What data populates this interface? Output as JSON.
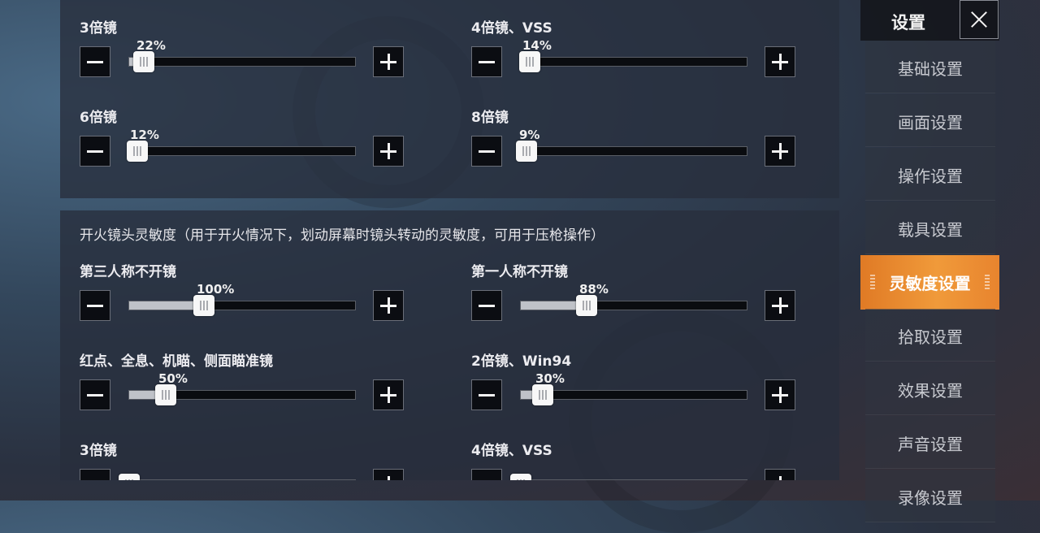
{
  "sidebar": {
    "title": "设置",
    "items": [
      {
        "label": "基础设置",
        "active": false
      },
      {
        "label": "画面设置",
        "active": false
      },
      {
        "label": "操作设置",
        "active": false
      },
      {
        "label": "载具设置",
        "active": false
      },
      {
        "label": "灵敏度设置",
        "active": true
      },
      {
        "label": "拾取设置",
        "active": false
      },
      {
        "label": "效果设置",
        "active": false
      },
      {
        "label": "声音设置",
        "active": false
      },
      {
        "label": "录像设置",
        "active": false
      }
    ]
  },
  "scope_section": {
    "settings": [
      {
        "label": "3倍镜",
        "value_text": "22%",
        "fraction": 0.065
      },
      {
        "label": "4倍镜、VSS",
        "value_text": "14%",
        "fraction": 0.04
      },
      {
        "label": "6倍镜",
        "value_text": "12%",
        "fraction": 0.035
      },
      {
        "label": "8倍镜",
        "value_text": "9%",
        "fraction": 0.026
      }
    ]
  },
  "fire_section": {
    "description": "开火镜头灵敏度（用于开火情况下，划动屏幕时镜头转动的灵敏度，可用于压枪操作）",
    "settings": [
      {
        "label": "第三人称不开镜",
        "value_text": "100%",
        "fraction": 0.33
      },
      {
        "label": "第一人称不开镜",
        "value_text": "88%",
        "fraction": 0.29
      },
      {
        "label": "红点、全息、机瞄、侧面瞄准镜",
        "value_text": "50%",
        "fraction": 0.16
      },
      {
        "label": "2倍镜、Win94",
        "value_text": "30%",
        "fraction": 0.095
      },
      {
        "label": "3倍镜",
        "value_text": "",
        "fraction": 0
      },
      {
        "label": "4倍镜、VSS",
        "value_text": "",
        "fraction": 0
      }
    ]
  },
  "icons": {
    "minus": "minus-icon",
    "plus": "plus-icon",
    "close": "close-icon"
  },
  "colors": {
    "accent": "#ee8c33",
    "button_bg": "#0b0d12",
    "track_fill": "#bfc2c8"
  }
}
